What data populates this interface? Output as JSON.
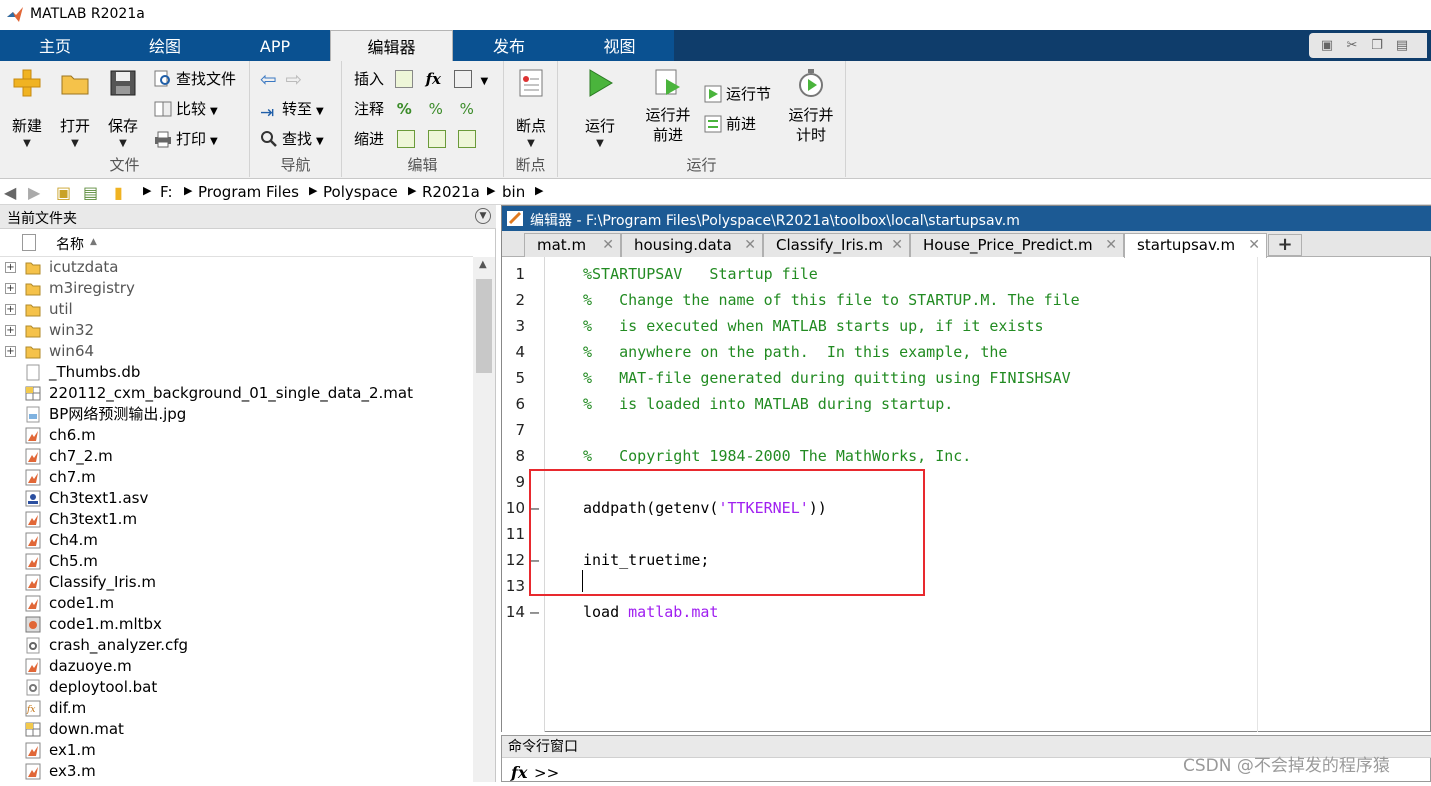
{
  "window": {
    "title": "MATLAB R2021a"
  },
  "ribbon_tabs": [
    {
      "label": "主页"
    },
    {
      "label": "绘图"
    },
    {
      "label": "APP"
    },
    {
      "label": "编辑器"
    },
    {
      "label": "发布"
    },
    {
      "label": "视图"
    }
  ],
  "active_tab": "编辑器",
  "ribbon": {
    "file": {
      "label": "文件",
      "new": "新建",
      "open": "打开",
      "save": "保存",
      "find_files": "查找文件",
      "compare": "比较",
      "print": "打印"
    },
    "navigate": {
      "label": "导航",
      "goto": "转至",
      "find": "查找"
    },
    "edit": {
      "label": "编辑",
      "insert": "插入",
      "comment": "注释",
      "indent": "缩进"
    },
    "breakpoints": {
      "label": "断点",
      "breakpoints": "断点"
    },
    "run": {
      "label": "运行",
      "run": "运行",
      "run_advance": "运行并\n前进",
      "run_section": "运行节",
      "advance": "前进",
      "run_time": "运行并\n计时"
    }
  },
  "address": {
    "crumbs": [
      "F:",
      "Program Files",
      "Polyspace",
      "R2021a",
      "bin"
    ]
  },
  "file_panel": {
    "title": "当前文件夹",
    "column_name": "名称",
    "files": [
      {
        "name": "icutzdata",
        "type": "folder"
      },
      {
        "name": "m3iregistry",
        "type": "folder"
      },
      {
        "name": "util",
        "type": "folder"
      },
      {
        "name": "win32",
        "type": "folder"
      },
      {
        "name": "win64",
        "type": "folder"
      },
      {
        "name": "_Thumbs.db",
        "type": "db"
      },
      {
        "name": "220112_cxm_background_01_single_data_2.mat",
        "type": "mat"
      },
      {
        "name": "BP网络预测输出.jpg",
        "type": "jpg"
      },
      {
        "name": "ch6.m",
        "type": "m"
      },
      {
        "name": "ch7_2.m",
        "type": "m"
      },
      {
        "name": "ch7.m",
        "type": "m"
      },
      {
        "name": "Ch3text1.asv",
        "type": "asv"
      },
      {
        "name": "Ch3text1.m",
        "type": "m"
      },
      {
        "name": "Ch4.m",
        "type": "m"
      },
      {
        "name": "Ch5.m",
        "type": "m"
      },
      {
        "name": "Classify_Iris.m",
        "type": "m"
      },
      {
        "name": "code1.m",
        "type": "m"
      },
      {
        "name": "code1.m.mltbx",
        "type": "mltbx"
      },
      {
        "name": "crash_analyzer.cfg",
        "type": "cfg"
      },
      {
        "name": "dazuoye.m",
        "type": "m"
      },
      {
        "name": "deploytool.bat",
        "type": "bat"
      },
      {
        "name": "dif.m",
        "type": "fx"
      },
      {
        "name": "down.mat",
        "type": "mat"
      },
      {
        "name": "ex1.m",
        "type": "m"
      },
      {
        "name": "ex3.m",
        "type": "m"
      }
    ]
  },
  "editor": {
    "title": "编辑器 - F:\\Program Files\\Polyspace\\R2021a\\toolbox\\local\\startupsav.m",
    "tabs": [
      {
        "label": "mat.m"
      },
      {
        "label": "housing.data"
      },
      {
        "label": "Classify_Iris.m"
      },
      {
        "label": "House_Price_Predict.m"
      },
      {
        "label": "startupsav.m"
      }
    ],
    "active_tab": "startupsav.m",
    "plus": "+",
    "close": "✕",
    "lines": [
      {
        "n": "1",
        "bp": "",
        "parts": [
          {
            "t": "%STARTUPSAV   Startup file",
            "c": "cmt"
          }
        ]
      },
      {
        "n": "2",
        "bp": "",
        "parts": [
          {
            "t": "%   Change the name of this file to STARTUP.M. The file",
            "c": "cmt"
          }
        ]
      },
      {
        "n": "3",
        "bp": "",
        "parts": [
          {
            "t": "%   is executed when MATLAB starts up, if it exists",
            "c": "cmt"
          }
        ]
      },
      {
        "n": "4",
        "bp": "",
        "parts": [
          {
            "t": "%   anywhere on the path.  In this example, the",
            "c": "cmt"
          }
        ]
      },
      {
        "n": "5",
        "bp": "",
        "parts": [
          {
            "t": "%   MAT-file generated during quitting using FINISHSAV",
            "c": "cmt"
          }
        ]
      },
      {
        "n": "6",
        "bp": "",
        "parts": [
          {
            "t": "%   is loaded into MATLAB during startup.",
            "c": "cmt"
          }
        ]
      },
      {
        "n": "7",
        "bp": "",
        "parts": []
      },
      {
        "n": "8",
        "bp": "",
        "parts": [
          {
            "t": "%   Copyright 1984-2000 The MathWorks, Inc.",
            "c": "cmt"
          }
        ]
      },
      {
        "n": "9",
        "bp": "",
        "parts": []
      },
      {
        "n": "10",
        "bp": "–",
        "parts": [
          {
            "t": "addpath(getenv(",
            "c": ""
          },
          {
            "t": "'TTKERNEL'",
            "c": "str"
          },
          {
            "t": "))",
            "c": ""
          }
        ]
      },
      {
        "n": "11",
        "bp": "",
        "parts": []
      },
      {
        "n": "12",
        "bp": "–",
        "parts": [
          {
            "t": "init_truetime;",
            "c": ""
          }
        ]
      },
      {
        "n": "13",
        "bp": "",
        "parts": []
      },
      {
        "n": "14",
        "bp": "–",
        "parts": [
          {
            "t": "load ",
            "c": ""
          },
          {
            "t": "matlab.mat",
            "c": "str"
          }
        ]
      }
    ]
  },
  "command_window": {
    "title": "命令行窗口",
    "fx": "fx",
    "prompt": ">>"
  },
  "watermark": "CSDN @不会掉发的程序猿",
  "colors": {
    "tab_blue": "#0a5191",
    "editor_header": "#1c5a94",
    "comment": "#228b22",
    "string": "#a020f0",
    "highlight_box": "#e8292e"
  }
}
